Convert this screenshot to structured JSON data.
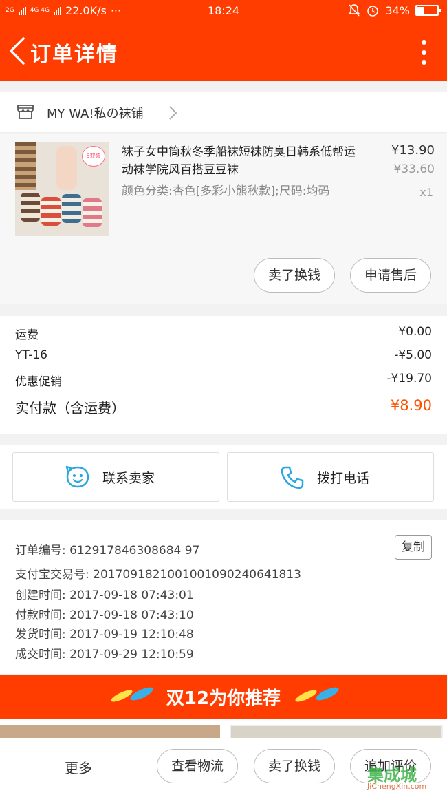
{
  "status_bar": {
    "sig1": "2G",
    "sig2": "4G 4G",
    "speed": "22.0K/s",
    "dots": "···",
    "time": "18:24",
    "battery": "34%",
    "battery_level": 0.34
  },
  "header": {
    "title": "订单详情"
  },
  "shop": {
    "name": "MY WA!私の袜铺"
  },
  "product": {
    "name": "袜子女中筒秋冬季船袜短袜防臭日韩系低帮运动袜学院风百搭豆豆袜",
    "spec": "颜色分类:杏色[多彩小熊秋款];尺码:均码",
    "price": "¥13.90",
    "orig_price": "¥33.60",
    "qty": "x1",
    "thumb_tag": "5双装",
    "btn_resell": "卖了换钱",
    "btn_aftersale": "申请售后"
  },
  "summary": {
    "rows": [
      {
        "label": "运费",
        "value": "¥0.00"
      },
      {
        "label": "YT-16",
        "value": "-¥5.00"
      },
      {
        "label": "优惠促销",
        "value": "-¥19.70"
      }
    ],
    "total_label": "实付款（含运费）",
    "total_value": "¥8.90"
  },
  "contact": {
    "seller_label": "联系卖家",
    "phone_label": "拨打电话"
  },
  "order_info": {
    "order_no": "订单编号: 612917846308684 97",
    "alipay_no": "支付宝交易号: 2017091821001001090240641813",
    "created": "创建时间: 2017-09-18 07:43:01",
    "paid": "付款时间: 2017-09-18 07:43:10",
    "shipped": "发货时间: 2017-09-19 12:10:48",
    "completed": "成交时间: 2017-09-29 12:10:59",
    "copy_label": "复制"
  },
  "banner": {
    "text": "双12为你推荐"
  },
  "bottom": {
    "more": "更多",
    "logistics": "查看物流",
    "resell": "卖了换钱",
    "review": "追加评价"
  },
  "watermark": {
    "text": "集成城",
    "sub": "JiChengXin.com"
  },
  "colors": {
    "brand": "#ff3d00",
    "accent": "#ff5000"
  }
}
